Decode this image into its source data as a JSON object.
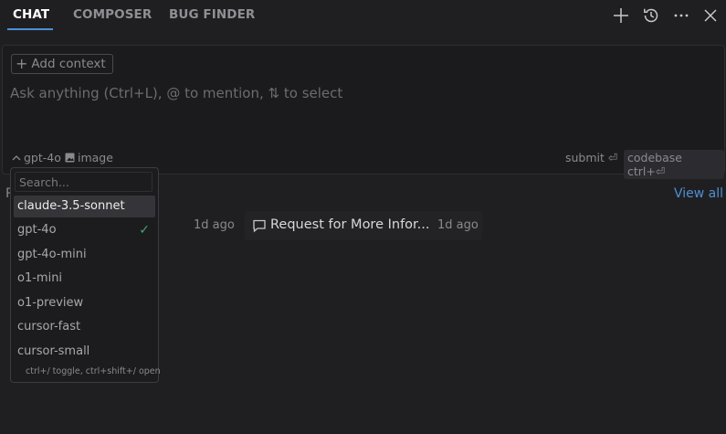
{
  "tabs": [
    {
      "label": "CHAT",
      "active": true
    },
    {
      "label": "COMPOSER",
      "active": false
    },
    {
      "label": "BUG FINDER",
      "active": false
    }
  ],
  "header_icons": [
    "plus-icon",
    "history-icon",
    "more-icon",
    "close-icon"
  ],
  "input": {
    "add_context": "Add context",
    "placeholder": "Ask anything (Ctrl+L), @ to mention, ⇅ to select",
    "model": "gpt-4o",
    "image": "image",
    "submit": "submit ⏎",
    "codebase": "codebase ctrl+⏎"
  },
  "recent": {
    "label": "P",
    "view_all": "View all",
    "items": [
      {
        "time": "1d ago"
      },
      {
        "title": "Request for More Infor...",
        "time": "1d ago"
      }
    ]
  },
  "model_dropdown": {
    "search_placeholder": "Search...",
    "options": [
      "claude-3.5-sonnet",
      "gpt-4o",
      "gpt-4o-mini",
      "o1-mini",
      "o1-preview",
      "cursor-fast",
      "cursor-small"
    ],
    "highlighted": "claude-3.5-sonnet",
    "selected": "gpt-4o",
    "hint": "ctrl+/ toggle, ctrl+shift+/ open"
  },
  "colors": {
    "background": "#1f1f22",
    "accent": "#4d8fd6",
    "check": "#3fa66b"
  }
}
